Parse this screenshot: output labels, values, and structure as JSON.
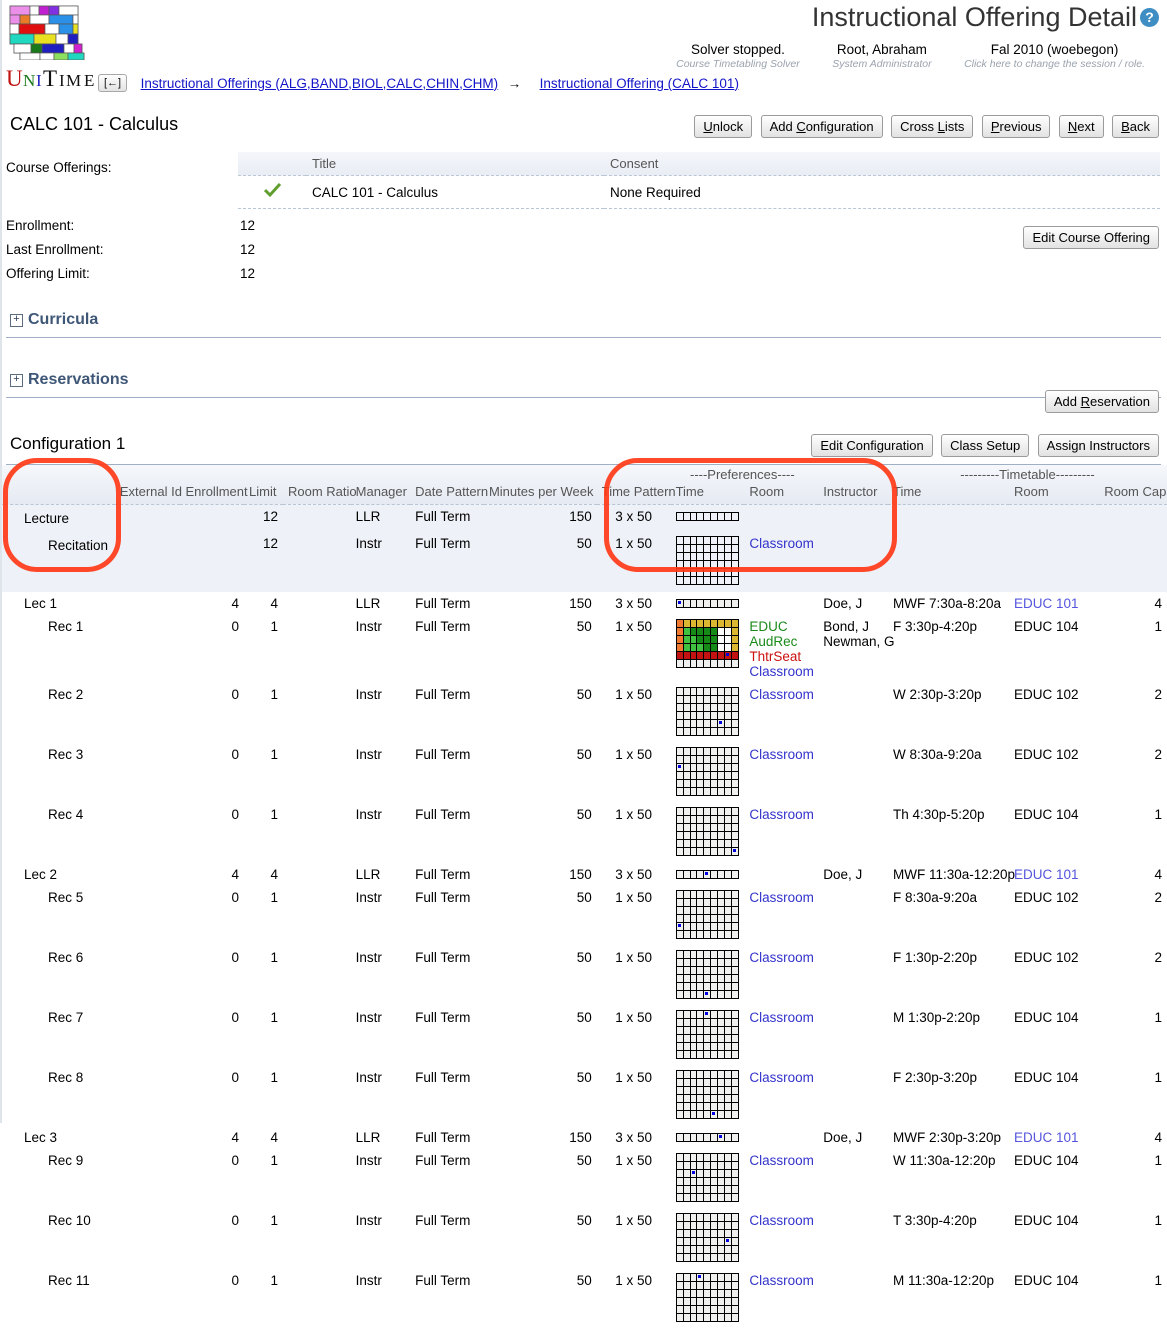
{
  "header": {
    "page_title": "Instructional Offering Detail",
    "help_icon": "question-mark-icon",
    "status": [
      {
        "main": "Solver stopped.",
        "sub": "Course Timetabling Solver"
      },
      {
        "main": "Root, Abraham",
        "sub": "System Administrator"
      },
      {
        "main": "Fal 2010 (woebegon)",
        "sub": "Click here to change the session / role."
      }
    ],
    "back_button": "[←]",
    "breadcrumb": [
      "Instructional Offerings (ALG,BAND,BIOL,CALC,CHIN,CHM)",
      "Instructional Offering (CALC 101)"
    ],
    "breadcrumb_separator": "→"
  },
  "course": {
    "name": "CALC 101 - Calculus",
    "toolbar": [
      "Unlock",
      "Add Configuration",
      "Cross Lists",
      "Previous",
      "Next",
      "Back"
    ]
  },
  "course_offerings": {
    "label": "Course Offerings:",
    "columns": [
      "",
      "Title",
      "Consent",
      ""
    ],
    "rows": [
      {
        "checked": "check-icon",
        "title": "CALC 101 - Calculus",
        "consent": "None Required",
        "action": "Edit Course Offering"
      }
    ],
    "stats": [
      {
        "label": "Enrollment:",
        "value": "12"
      },
      {
        "label": "Last Enrollment:",
        "value": "12"
      },
      {
        "label": "Offering Limit:",
        "value": "12"
      }
    ]
  },
  "sections": [
    {
      "title": "Curricula",
      "toggle": "+",
      "action": null
    },
    {
      "title": "Reservations",
      "toggle": "+",
      "action": "Add Reservation"
    }
  ],
  "configuration": {
    "title": "Configuration 1",
    "buttons": [
      "Edit Configuration",
      "Class Setup",
      "Assign Instructors"
    ]
  },
  "class_table": {
    "group_headers": [
      {
        "label": "----Preferences----",
        "span": 4
      },
      {
        "label": "---------Timetable---------",
        "span": 3
      }
    ],
    "columns": [
      "",
      "External Id",
      "Enrollment",
      "Limit",
      "Room Ratio",
      "Manager",
      "Date Pattern",
      "Minutes per Week",
      "Time Pattern",
      "Time",
      "Room",
      "Instructor",
      "Time",
      "Room",
      "Room Cap"
    ],
    "subparts": [
      {
        "name": "Lecture",
        "indent": 0,
        "external_id": "",
        "enrollment": "",
        "limit": "12",
        "room_ratio": "",
        "manager": "LLR",
        "date_pattern": "Full Term",
        "minutes_per_week": "150",
        "time_pattern": "3 x 50",
        "pref_grid": "row9",
        "pref_room": "",
        "pref_instructor": "",
        "tt_time": "",
        "tt_room": "",
        "tt_room_cap": ""
      },
      {
        "name": "Recitation",
        "indent": 1,
        "external_id": "",
        "enrollment": "",
        "limit": "12",
        "room_ratio": "",
        "manager": "Instr",
        "date_pattern": "Full Term",
        "minutes_per_week": "50",
        "time_pattern": "1 x 50",
        "pref_grid": "full",
        "pref_room": "Classroom",
        "pref_instructor": "",
        "tt_time": "",
        "tt_room": "",
        "tt_room_cap": ""
      }
    ],
    "classes": [
      {
        "name": "Lec 1",
        "indent": 0,
        "external_id": "",
        "enrollment": "4",
        "limit": "4",
        "room_ratio": "",
        "manager": "LLR",
        "date_pattern": "Full Term",
        "minutes_per_week": "150",
        "time_pattern": "3 x 50",
        "pref_grid": "row9",
        "pref_grid_sel": 0,
        "pref_rooms": [],
        "pref_instructor": "Doe, J",
        "tt_time": "MWF 7:30a-8:20a",
        "tt_room": "EDUC 101",
        "tt_room_link": true,
        "tt_room_cap": "4"
      },
      {
        "name": "Rec 1",
        "indent": 1,
        "external_id": "",
        "enrollment": "0",
        "limit": "1",
        "room_ratio": "",
        "manager": "Instr",
        "date_pattern": "Full Term",
        "minutes_per_week": "50",
        "time_pattern": "1 x 50",
        "pref_grid": "colored",
        "pref_grid_sel": null,
        "pref_rooms": [
          {
            "text": "EDUC",
            "style": "green"
          },
          {
            "text": "AudRec",
            "style": "green"
          },
          {
            "text": "ThtrSeat",
            "style": "red"
          },
          {
            "text": "Classroom",
            "style": "blue"
          }
        ],
        "pref_instructor": "Bond, J\nNewman, G",
        "tt_time": "F 3:30p-4:20p",
        "tt_room": "EDUC 104",
        "tt_room_link": false,
        "tt_room_cap": "1"
      },
      {
        "name": "Rec 2",
        "indent": 1,
        "external_id": "",
        "enrollment": "0",
        "limit": "1",
        "room_ratio": "",
        "manager": "Instr",
        "date_pattern": "Full Term",
        "minutes_per_week": "50",
        "time_pattern": "1 x 50",
        "pref_grid": "full",
        "pref_grid_sel": [
          4,
          6
        ],
        "pref_rooms": [
          {
            "text": "Classroom",
            "style": "blue"
          }
        ],
        "pref_instructor": "",
        "tt_time": "W 2:30p-3:20p",
        "tt_room": "EDUC 102",
        "tt_room_link": false,
        "tt_room_cap": "2"
      },
      {
        "name": "Rec 3",
        "indent": 1,
        "external_id": "",
        "enrollment": "0",
        "limit": "1",
        "room_ratio": "",
        "manager": "Instr",
        "date_pattern": "Full Term",
        "minutes_per_week": "50",
        "time_pattern": "1 x 50",
        "pref_grid": "full",
        "pref_grid_sel": [
          2,
          0
        ],
        "pref_rooms": [
          {
            "text": "Classroom",
            "style": "blue"
          }
        ],
        "pref_instructor": "",
        "tt_time": "W 8:30a-9:20a",
        "tt_room": "EDUC 102",
        "tt_room_link": false,
        "tt_room_cap": "2"
      },
      {
        "name": "Rec 4",
        "indent": 1,
        "external_id": "",
        "enrollment": "0",
        "limit": "1",
        "room_ratio": "",
        "manager": "Instr",
        "date_pattern": "Full Term",
        "minutes_per_week": "50",
        "time_pattern": "1 x 50",
        "pref_grid": "full",
        "pref_grid_sel": [
          5,
          8
        ],
        "pref_rooms": [
          {
            "text": "Classroom",
            "style": "blue"
          }
        ],
        "pref_instructor": "",
        "tt_time": "Th 4:30p-5:20p",
        "tt_room": "EDUC 104",
        "tt_room_link": false,
        "tt_room_cap": "1"
      },
      {
        "name": "Lec 2",
        "indent": 0,
        "external_id": "",
        "enrollment": "4",
        "limit": "4",
        "room_ratio": "",
        "manager": "LLR",
        "date_pattern": "Full Term",
        "minutes_per_week": "150",
        "time_pattern": "3 x 50",
        "pref_grid": "row9",
        "pref_grid_sel": 4,
        "pref_rooms": [],
        "pref_instructor": "Doe, J",
        "tt_time": "MWF 11:30a-12:20p",
        "tt_room": "EDUC 101",
        "tt_room_link": true,
        "tt_room_cap": "4"
      },
      {
        "name": "Rec 5",
        "indent": 1,
        "external_id": "",
        "enrollment": "0",
        "limit": "1",
        "room_ratio": "",
        "manager": "Instr",
        "date_pattern": "Full Term",
        "minutes_per_week": "50",
        "time_pattern": "1 x 50",
        "pref_grid": "full",
        "pref_grid_sel": [
          4,
          0
        ],
        "pref_rooms": [
          {
            "text": "Classroom",
            "style": "blue"
          }
        ],
        "pref_instructor": "",
        "tt_time": "F 8:30a-9:20a",
        "tt_room": "EDUC 102",
        "tt_room_link": false,
        "tt_room_cap": "2"
      },
      {
        "name": "Rec 6",
        "indent": 1,
        "external_id": "",
        "enrollment": "0",
        "limit": "1",
        "room_ratio": "",
        "manager": "Instr",
        "date_pattern": "Full Term",
        "minutes_per_week": "50",
        "time_pattern": "1 x 50",
        "pref_grid": "full",
        "pref_grid_sel": [
          5,
          4
        ],
        "pref_rooms": [
          {
            "text": "Classroom",
            "style": "blue"
          }
        ],
        "pref_instructor": "",
        "tt_time": "F 1:30p-2:20p",
        "tt_room": "EDUC 102",
        "tt_room_link": false,
        "tt_room_cap": "2"
      },
      {
        "name": "Rec 7",
        "indent": 1,
        "external_id": "",
        "enrollment": "0",
        "limit": "1",
        "room_ratio": "",
        "manager": "Instr",
        "date_pattern": "Full Term",
        "minutes_per_week": "50",
        "time_pattern": "1 x 50",
        "pref_grid": "full",
        "pref_grid_sel": [
          0,
          4
        ],
        "pref_rooms": [
          {
            "text": "Classroom",
            "style": "blue"
          }
        ],
        "pref_instructor": "",
        "tt_time": "M 1:30p-2:20p",
        "tt_room": "EDUC 104",
        "tt_room_link": false,
        "tt_room_cap": "1"
      },
      {
        "name": "Rec 8",
        "indent": 1,
        "external_id": "",
        "enrollment": "0",
        "limit": "1",
        "room_ratio": "",
        "manager": "Instr",
        "date_pattern": "Full Term",
        "minutes_per_week": "50",
        "time_pattern": "1 x 50",
        "pref_grid": "full",
        "pref_grid_sel": [
          5,
          5
        ],
        "pref_rooms": [
          {
            "text": "Classroom",
            "style": "blue"
          }
        ],
        "pref_instructor": "",
        "tt_time": "F 2:30p-3:20p",
        "tt_room": "EDUC 104",
        "tt_room_link": false,
        "tt_room_cap": "1"
      },
      {
        "name": "Lec 3",
        "indent": 0,
        "external_id": "",
        "enrollment": "4",
        "limit": "4",
        "room_ratio": "",
        "manager": "LLR",
        "date_pattern": "Full Term",
        "minutes_per_week": "150",
        "time_pattern": "3 x 50",
        "pref_grid": "row9",
        "pref_grid_sel": 6,
        "pref_rooms": [],
        "pref_instructor": "Doe, J",
        "tt_time": "MWF 2:30p-3:20p",
        "tt_room": "EDUC 101",
        "tt_room_link": true,
        "tt_room_cap": "4"
      },
      {
        "name": "Rec 9",
        "indent": 1,
        "external_id": "",
        "enrollment": "0",
        "limit": "1",
        "room_ratio": "",
        "manager": "Instr",
        "date_pattern": "Full Term",
        "minutes_per_week": "50",
        "time_pattern": "1 x 50",
        "pref_grid": "full",
        "pref_grid_sel": [
          2,
          2
        ],
        "pref_rooms": [
          {
            "text": "Classroom",
            "style": "blue"
          }
        ],
        "pref_instructor": "",
        "tt_time": "W 11:30a-12:20p",
        "tt_room": "EDUC 104",
        "tt_room_link": false,
        "tt_room_cap": "1"
      },
      {
        "name": "Rec 10",
        "indent": 1,
        "external_id": "",
        "enrollment": "0",
        "limit": "1",
        "room_ratio": "",
        "manager": "Instr",
        "date_pattern": "Full Term",
        "minutes_per_week": "50",
        "time_pattern": "1 x 50",
        "pref_grid": "full",
        "pref_grid_sel": [
          3,
          7
        ],
        "pref_rooms": [
          {
            "text": "Classroom",
            "style": "blue"
          }
        ],
        "pref_instructor": "",
        "tt_time": "T 3:30p-4:20p",
        "tt_room": "EDUC 104",
        "tt_room_link": false,
        "tt_room_cap": "1"
      },
      {
        "name": "Rec 11",
        "indent": 1,
        "external_id": "",
        "enrollment": "0",
        "limit": "1",
        "room_ratio": "",
        "manager": "Instr",
        "date_pattern": "Full Term",
        "minutes_per_week": "50",
        "time_pattern": "1 x 50",
        "pref_grid": "full",
        "pref_grid_sel": [
          0,
          3
        ],
        "pref_rooms": [
          {
            "text": "Classroom",
            "style": "blue"
          }
        ],
        "pref_instructor": "",
        "tt_time": "M 11:30a-12:20p",
        "tt_room": "EDUC 104",
        "tt_room_link": false,
        "tt_room_cap": "1"
      }
    ]
  },
  "annotations": {
    "ovals": [
      "subpart-name-column",
      "preferences-column-group"
    ],
    "color": "#ff3a17"
  },
  "colors": {
    "link": "#1414c8",
    "section_title": "#3f5777",
    "help_badge": "#3e8ec4",
    "pref_green": "#1a8a1a",
    "pref_red": "#cc1111",
    "pref_blue": "#3333cc"
  }
}
